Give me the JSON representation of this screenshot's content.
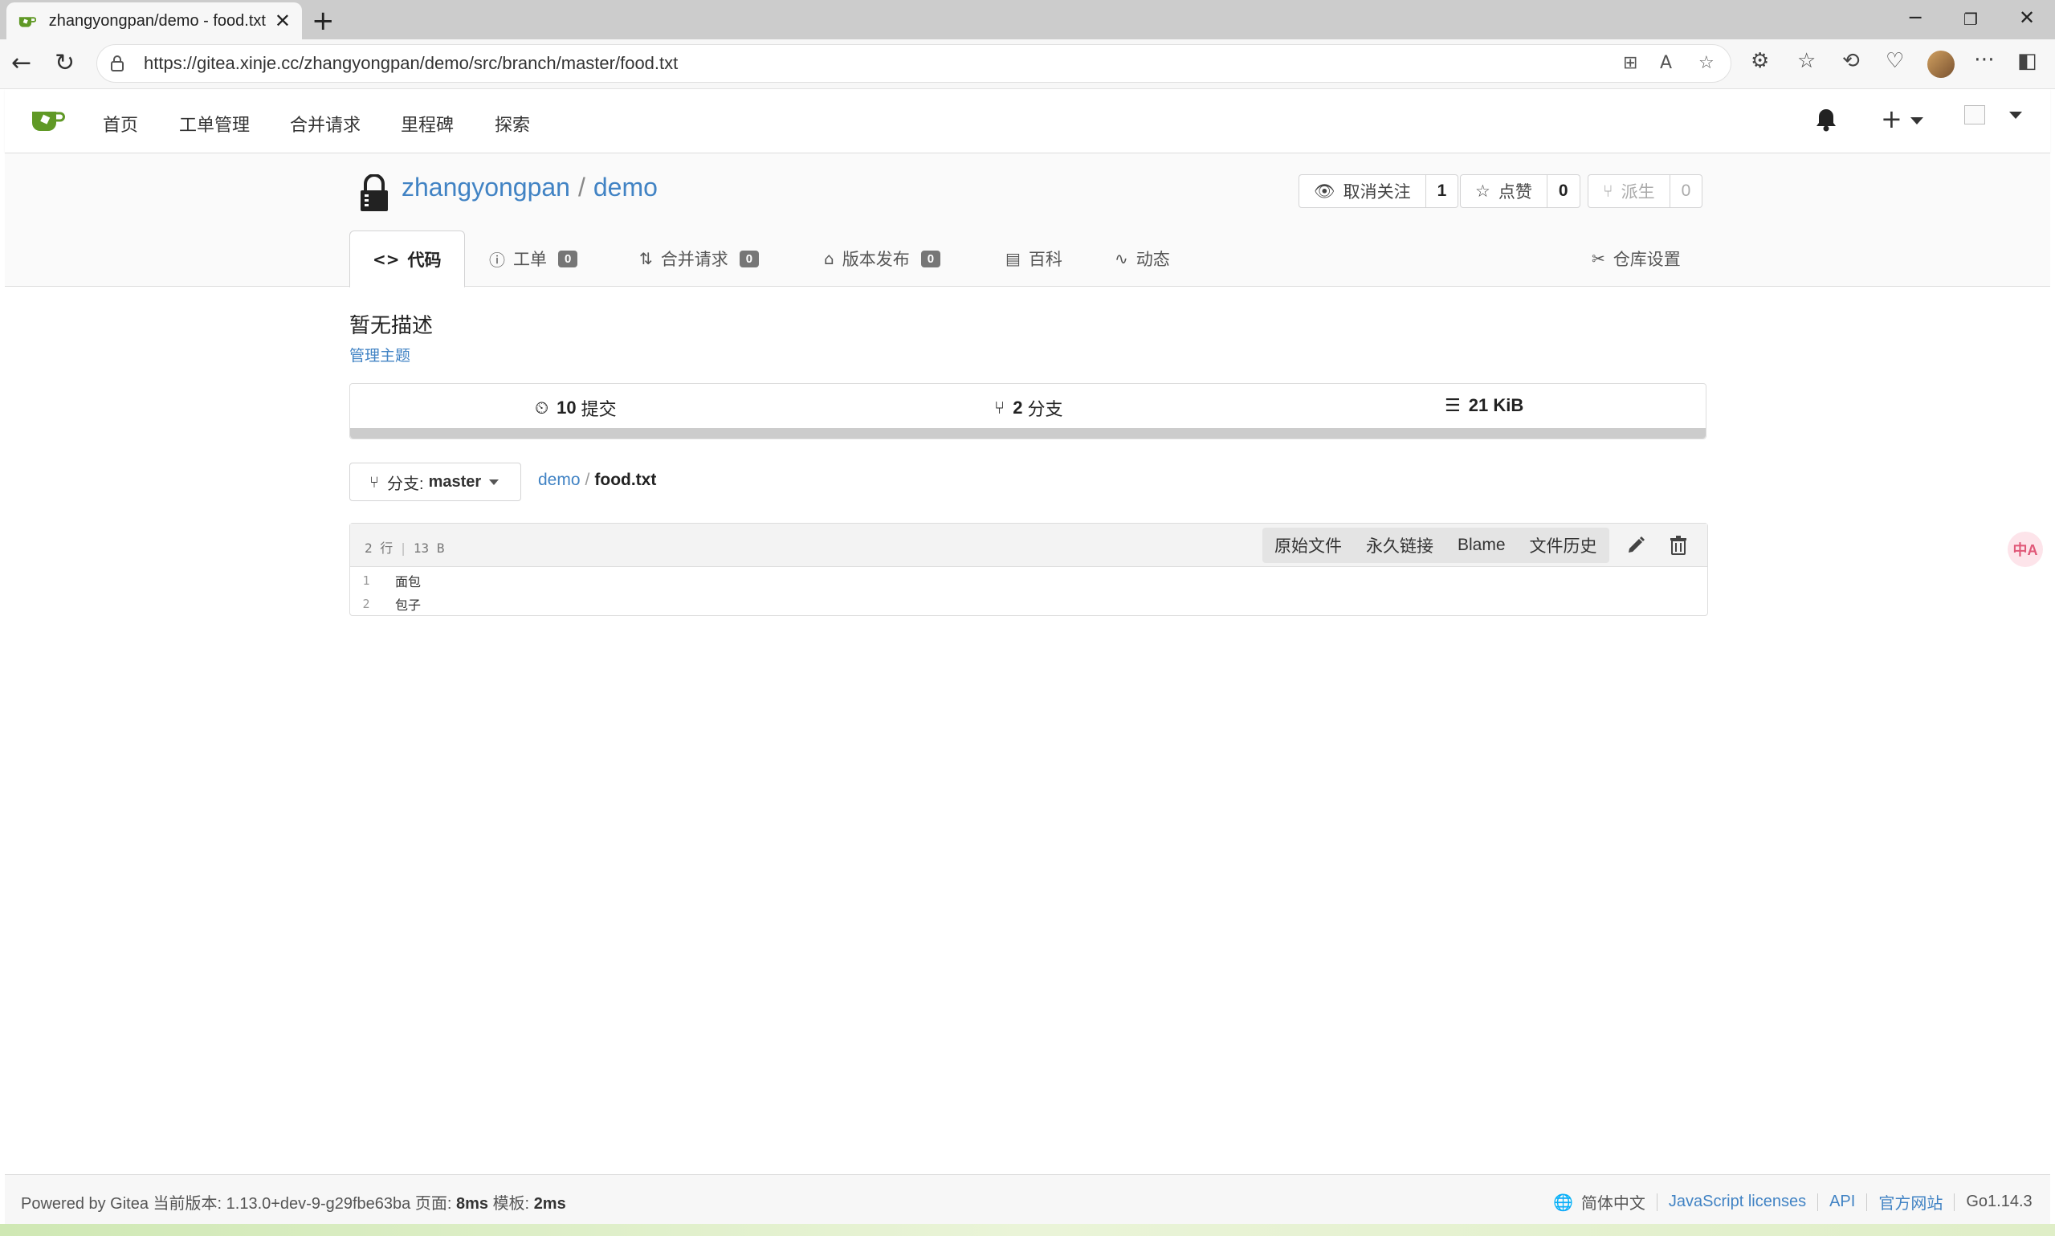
{
  "browser": {
    "tab_title": "zhangyongpan/demo - food.txt at master",
    "url": "https://gitea.xinje.cc/zhangyongpan/demo/src/branch/master/food.txt",
    "new_tab": "+",
    "close": "✕"
  },
  "nav": {
    "items": [
      "首页",
      "工单管理",
      "合并请求",
      "里程碑",
      "探索"
    ]
  },
  "repo": {
    "owner": "zhangyongpan",
    "name": "demo",
    "separator": "/",
    "watch": {
      "label": "取消关注",
      "count": "1"
    },
    "star": {
      "label": "点赞",
      "count": "0"
    },
    "fork": {
      "label": "派生",
      "count": "0"
    },
    "tabs": [
      {
        "label": "代码"
      },
      {
        "label": "工单",
        "badge": "0"
      },
      {
        "label": "合并请求",
        "badge": "0"
      },
      {
        "label": "版本发布",
        "badge": "0"
      },
      {
        "label": "百科"
      },
      {
        "label": "动态"
      }
    ],
    "settings": "仓库设置",
    "description": "暂无描述",
    "manage_topics": "管理主题",
    "stats": {
      "commits_count": "10",
      "commits_label": "提交",
      "branches_count": "2",
      "branches_label": "分支",
      "size": "21 KiB"
    }
  },
  "file": {
    "branch_prefix": "分支:",
    "branch_name": "master",
    "breadcrumb_root": "demo",
    "breadcrumb_file": "food.txt",
    "lines_info": "2 行",
    "size_info": "13 B",
    "actions": [
      "原始文件",
      "永久链接",
      "Blame",
      "文件历史"
    ],
    "lines": [
      {
        "n": "1",
        "text": "面包"
      },
      {
        "n": "2",
        "text": "包子"
      }
    ]
  },
  "footer": {
    "powered": "Powered by Gitea 当前版本: 1.13.0+dev-9-g29fbe63ba 页面:",
    "page_time": "8ms",
    "template_label": "模板:",
    "template_time": "2ms",
    "language": "简体中文",
    "js_licenses": "JavaScript licenses",
    "api": "API",
    "website": "官方网站",
    "go_version": "Go1.14.3"
  },
  "translate_fab": "中A"
}
